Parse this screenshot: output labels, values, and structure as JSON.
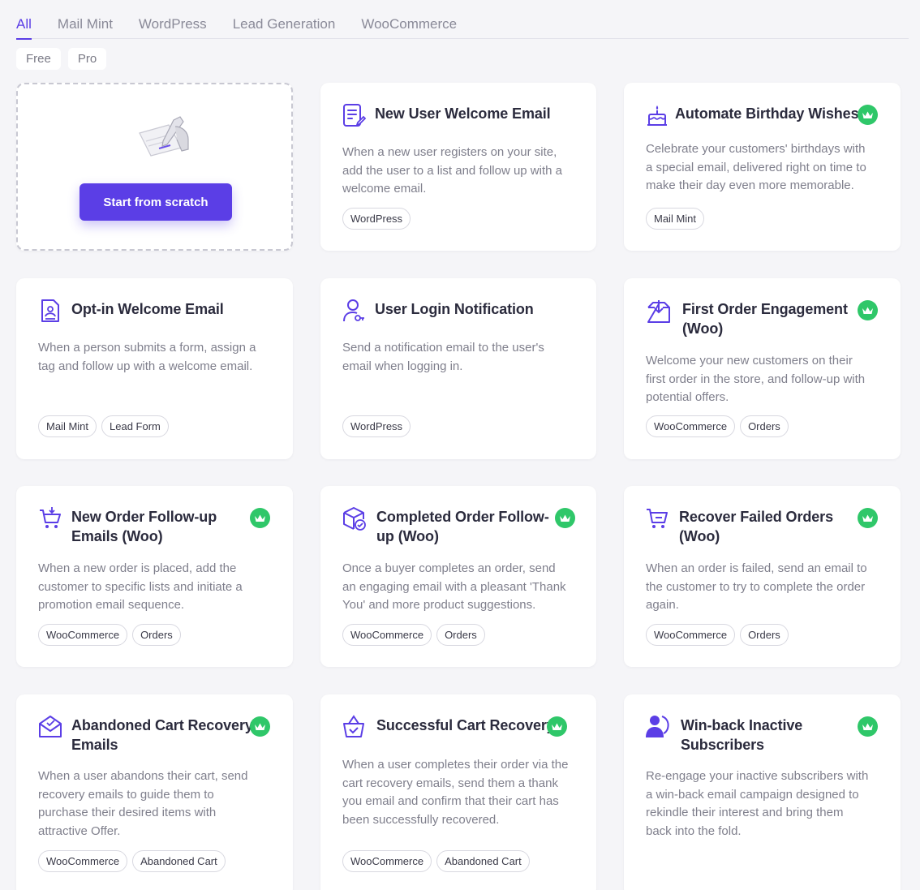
{
  "tabs": [
    "All",
    "Mail Mint",
    "WordPress",
    "Lead Generation",
    "WooCommerce"
  ],
  "filters": [
    "Free",
    "Pro"
  ],
  "scratch": {
    "button_label": "Start from scratch"
  },
  "colors": {
    "accent": "#5b3ee6",
    "pro_badge": "#2fc769"
  },
  "cards": [
    {
      "icon": "email-form-icon",
      "title_lines": [
        "New User Welcome Email"
      ],
      "pro": false,
      "description": [
        "When a new user registers on your site,",
        "add the user to a list and follow up with a",
        "welcome email."
      ],
      "tags": [
        "WordPress"
      ]
    },
    {
      "icon": "birthday-cake-icon",
      "title_lines": [
        "Automate Birthday Wishes"
      ],
      "pro": true,
      "description": [
        "Celebrate your customers' birthdays with",
        "a special email, delivered right on time to",
        "make their day even more memorable."
      ],
      "tags": [
        "Mail Mint"
      ]
    },
    {
      "icon": "optin-form-icon",
      "title_lines": [
        "Opt-in Welcome Email"
      ],
      "pro": false,
      "description": [
        "When a person submits a form, assign a",
        "tag and follow up with a welcome email."
      ],
      "tags": [
        "Mail Mint",
        "Lead Form"
      ]
    },
    {
      "icon": "user-key-icon",
      "title_lines": [
        "User Login Notification"
      ],
      "pro": false,
      "description": [
        "Send a notification email to the user's",
        "email when logging in."
      ],
      "tags": [
        "WordPress"
      ]
    },
    {
      "icon": "order-download-icon",
      "title_lines": [
        "First Order Engagement",
        "(Woo)"
      ],
      "pro": true,
      "description": [
        "Welcome your new customers on their",
        "first order in the store, and follow-up with",
        "potential offers."
      ],
      "tags": [
        "WooCommerce",
        "Orders"
      ]
    },
    {
      "icon": "cart-add-icon",
      "title_lines": [
        "New Order Follow-up",
        "Emails (Woo)"
      ],
      "pro": true,
      "description": [
        "When a new order is placed, add the",
        "customer to specific lists and initiate a",
        "promotion email sequence."
      ],
      "tags": [
        "WooCommerce",
        "Orders"
      ]
    },
    {
      "icon": "package-check-icon",
      "title_lines": [
        "Completed Order Follow-",
        "up (Woo)"
      ],
      "pro": true,
      "description": [
        "Once a buyer completes an order, send",
        "an engaging email with a pleasant 'Thank",
        "You' and more product suggestions."
      ],
      "tags": [
        "WooCommerce",
        "Orders"
      ]
    },
    {
      "icon": "cart-failed-icon",
      "title_lines": [
        "Recover Failed Orders",
        "(Woo)"
      ],
      "pro": true,
      "description": [
        "When an order is failed, send an email to",
        "the customer to try to complete the order",
        "again."
      ],
      "tags": [
        "WooCommerce",
        "Orders"
      ]
    },
    {
      "icon": "envelope-open-icon",
      "title_lines": [
        "Abandoned Cart Recovery",
        "Emails"
      ],
      "pro": true,
      "description": [
        "When a user abandons their cart, send",
        "recovery emails to guide them to",
        "purchase their desired items with",
        "attractive Offer."
      ],
      "tags": [
        "WooCommerce",
        "Abandoned Cart"
      ]
    },
    {
      "icon": "basket-check-icon",
      "title_lines": [
        "Successful Cart Recovery"
      ],
      "pro": true,
      "description": [
        "When a user completes their order via the",
        "cart recovery emails, send them a thank",
        "you email and confirm that their cart has",
        "been successfully recovered."
      ],
      "tags": [
        "WooCommerce",
        "Abandoned Cart"
      ]
    },
    {
      "icon": "user-return-icon",
      "title_lines": [
        "Win-back Inactive",
        "Subscribers"
      ],
      "pro": true,
      "description": [
        "Re-engage your inactive subscribers with",
        "a win-back email campaign designed to",
        "rekindle their interest and bring them",
        "back into the fold."
      ],
      "tags": []
    }
  ]
}
